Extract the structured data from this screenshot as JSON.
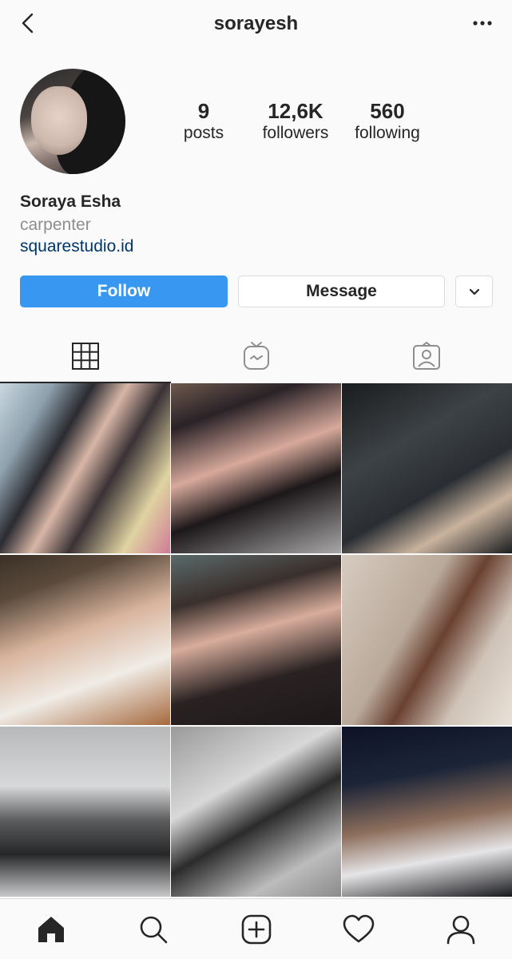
{
  "header": {
    "username": "sorayesh"
  },
  "profile": {
    "stats": [
      {
        "value": "9",
        "label": "posts"
      },
      {
        "value": "12,6K",
        "label": "followers"
      },
      {
        "value": "560",
        "label": "following"
      }
    ],
    "name": "Soraya Esha",
    "bio": "carpenter",
    "website": "squarestudio.id"
  },
  "actions": {
    "follow_label": "Follow",
    "message_label": "Message"
  },
  "tabs": [
    {
      "icon": "grid-icon",
      "active": true
    },
    {
      "icon": "igtv-icon",
      "active": false
    },
    {
      "icon": "tagged-icon",
      "active": false
    }
  ],
  "bottom_nav": [
    "home-icon",
    "search-icon",
    "add-post-icon",
    "heart-icon",
    "profile-icon"
  ],
  "colors": {
    "accent": "#3897f0",
    "link": "#00376b",
    "text": "#262626",
    "muted": "#8e8e8e"
  }
}
